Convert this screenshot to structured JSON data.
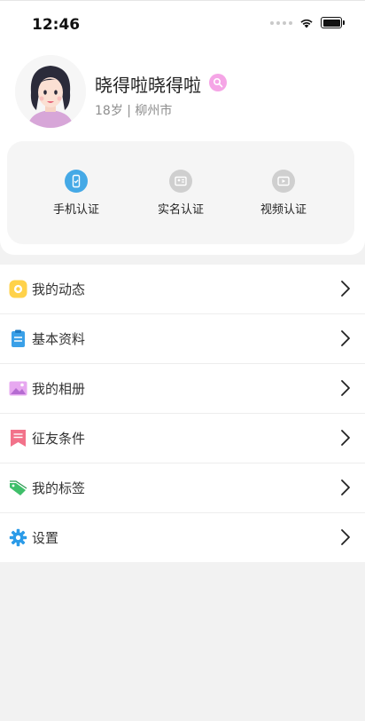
{
  "status": {
    "time": "12:46"
  },
  "profile": {
    "name": "晓得啦晓得啦",
    "meta": "18岁 | 柳州市"
  },
  "verify": [
    {
      "label": "手机认证",
      "icon": "phone-verify-icon",
      "active": true
    },
    {
      "label": "实名认证",
      "icon": "id-card-icon",
      "active": false
    },
    {
      "label": "视频认证",
      "icon": "video-icon",
      "active": false
    }
  ],
  "menu": [
    {
      "label": "我的动态",
      "icon": "moments-icon"
    },
    {
      "label": "基本资料",
      "icon": "clipboard-icon"
    },
    {
      "label": "我的相册",
      "icon": "album-icon"
    },
    {
      "label": "征友条件",
      "icon": "bookmark-icon"
    },
    {
      "label": "我的标签",
      "icon": "tag-icon"
    },
    {
      "label": "设置",
      "icon": "gear-icon"
    }
  ],
  "colors": {
    "accent_pink": "#f5a5e6",
    "phone_verify_blue": "#45a9e6",
    "inactive_gray": "#cfcfcf",
    "background": "#f2f2f2"
  }
}
